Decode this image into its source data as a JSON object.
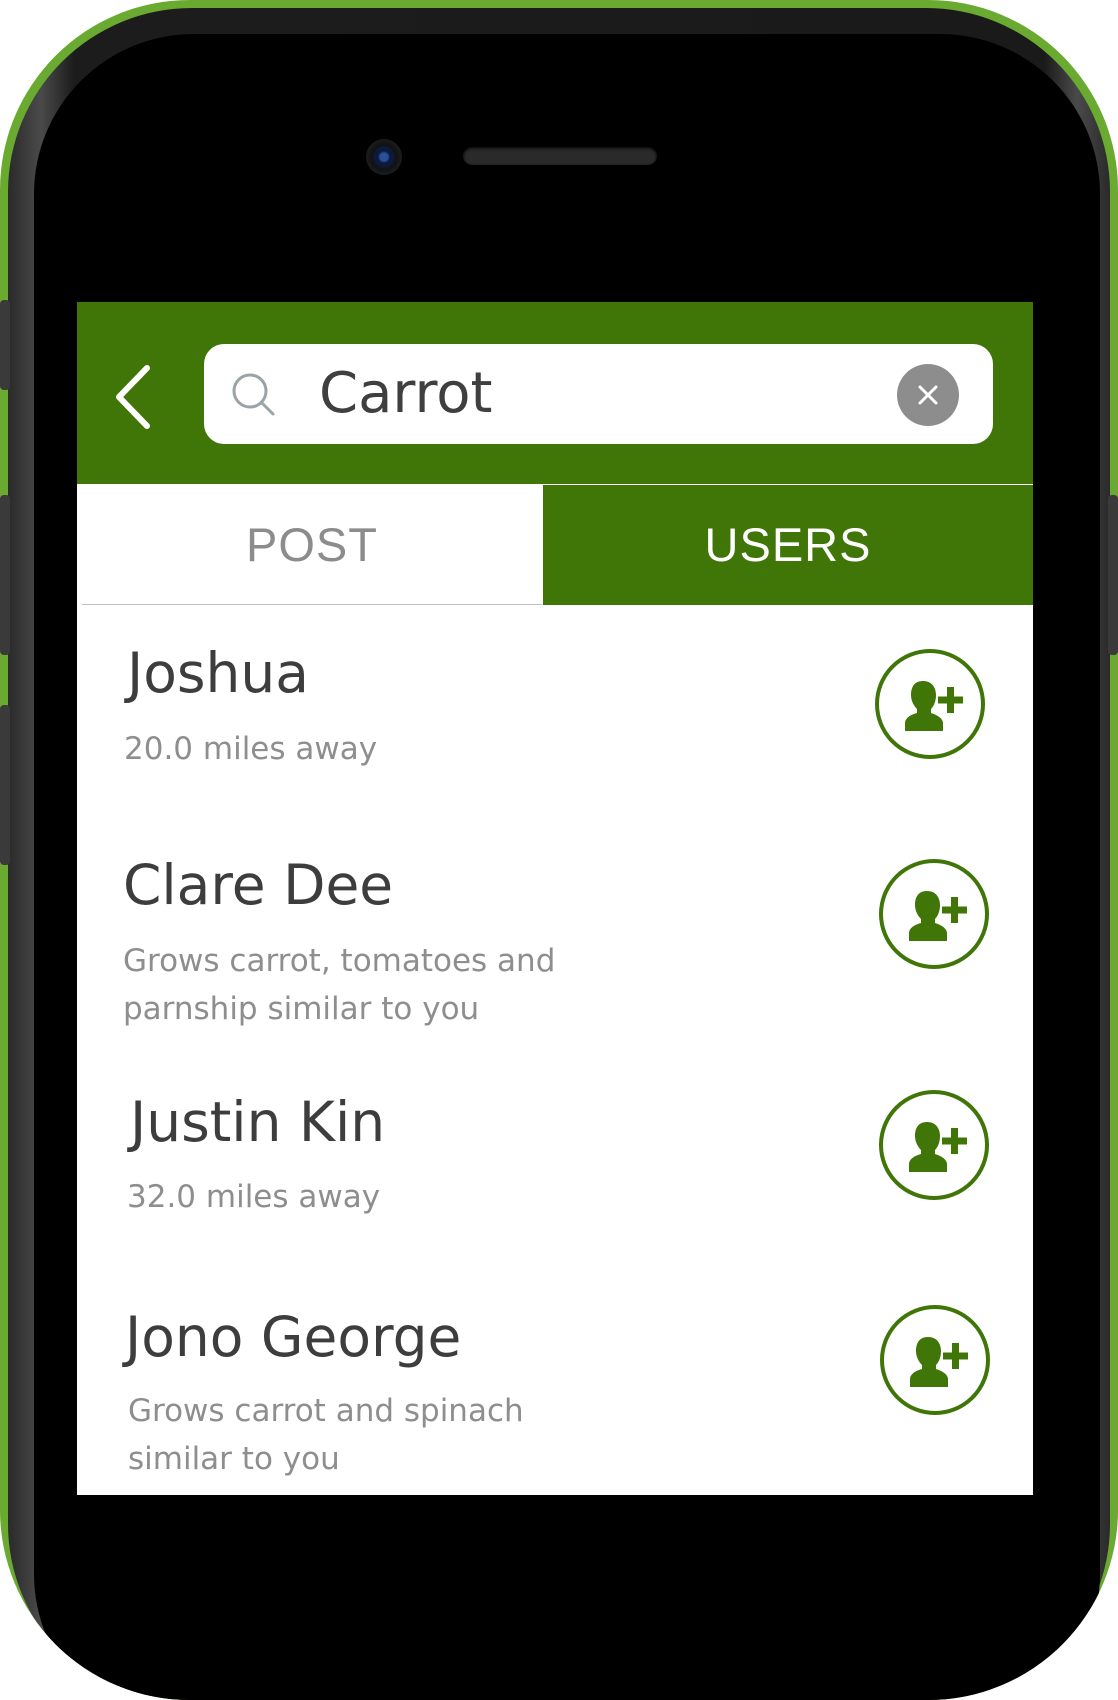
{
  "search": {
    "value": "Carrot",
    "clear_label": "×"
  },
  "tabs": [
    {
      "label": "POST",
      "active": false
    },
    {
      "label": "USERS",
      "active": true
    }
  ],
  "users": [
    {
      "name": "Joshua",
      "subtitle": "20.0 miles away"
    },
    {
      "name": "Clare Dee",
      "subtitle": "Grows carrot, tomatoes and parnship similar to you"
    },
    {
      "name": "Justin Kin",
      "subtitle": "32.0 miles away"
    },
    {
      "name": "Jono George",
      "subtitle": "Grows carrot and spinach similar to you"
    }
  ],
  "colors": {
    "brand_green": "#407508",
    "phone_accent": "#6aaa30",
    "text_primary": "#3d3d3d",
    "text_secondary": "#8e8e8e"
  },
  "icons": {
    "back": "chevron-left-icon",
    "search": "search-icon",
    "clear": "close-icon",
    "add_user": "add-user-icon"
  }
}
